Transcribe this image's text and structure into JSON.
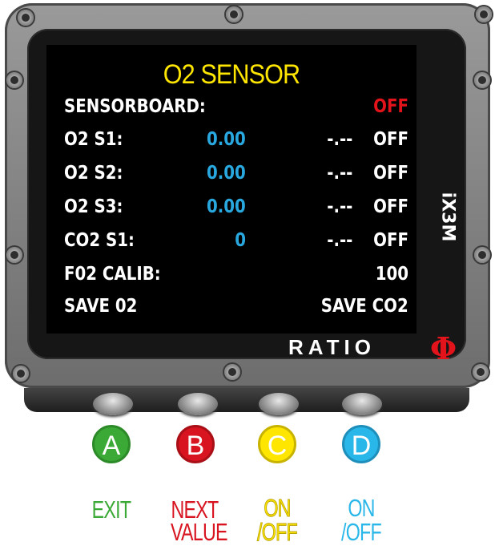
{
  "screen": {
    "title": "O2 SENSOR",
    "rows": [
      {
        "label": "SENSORBOARD:",
        "value": "",
        "mv": "",
        "status": "OFF"
      },
      {
        "label": "O2 S1:",
        "value": "0.00",
        "mv": "-.--",
        "status": "OFF"
      },
      {
        "label": "O2 S2:",
        "value": "0.00",
        "mv": "-.--",
        "status": "OFF"
      },
      {
        "label": "O2 S3:",
        "value": "0.00",
        "mv": "-.--",
        "status": "OFF"
      },
      {
        "label": "CO2 S1:",
        "value": "0",
        "mv": "-.--",
        "status": "OFF"
      }
    ],
    "calib_label": "F02 CALIB:",
    "calib_value": "100",
    "save_o2": "SAVE 02",
    "save_co2": "SAVE CO2"
  },
  "device": {
    "model": "iX3M",
    "brand": "RATIO",
    "brand_symbol": "Φ"
  },
  "buttons": [
    {
      "letter": "A",
      "label_line1": "EXIT",
      "label_line2": "",
      "color": "#3aa935"
    },
    {
      "letter": "B",
      "label_line1": "NEXT",
      "label_line2": "VALUE",
      "color": "#d7141f"
    },
    {
      "letter": "C",
      "label_line1": "ON",
      "label_line2": "/OFF",
      "color": "#ffe600"
    },
    {
      "letter": "D",
      "label_line1": "ON",
      "label_line2": "/OFF",
      "color": "#29b6e8"
    }
  ],
  "colors": {
    "title": "#ffe600",
    "value": "#29a8e0",
    "off_red": "#e2131b",
    "text": "#ffffff"
  }
}
